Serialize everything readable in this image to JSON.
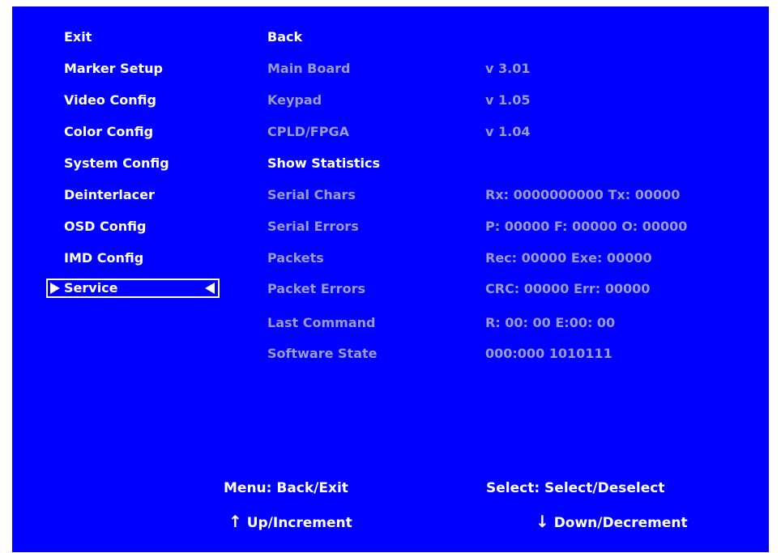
{
  "menu": {
    "items": [
      "Exit",
      "Marker Setup",
      "Video Config",
      "Color Config",
      "System Config",
      "Deinterlacer",
      "OSD Config",
      "IMD Config"
    ],
    "selected": "Service"
  },
  "sub": {
    "back": "Back",
    "main_board": "Main Board",
    "keypad": "Keypad",
    "cpld": "CPLD/FPGA",
    "show_stats": "Show Statistics",
    "serial_chars": "Serial Chars",
    "serial_errors": "Serial Errors",
    "packets": "Packets",
    "packet_errors": "Packet Errors",
    "last_command": "Last Command",
    "software_state": "Software State"
  },
  "values": {
    "main_board": "v 3.01",
    "keypad": "v 1.05",
    "cpld": "v 1.04",
    "serial_chars": "Rx: 0000000000 Tx: 00000",
    "serial_errors": "P: 00000 F: 00000 O: 00000",
    "packets": "Rec: 00000 Exe: 00000",
    "packet_errors": "CRC: 00000 Err: 00000",
    "last_command": "R: 00: 00 E:00: 00",
    "software_state": "000:000 1010111"
  },
  "footer": {
    "menu": "Menu: Back/Exit",
    "select": "Select: Select/Deselect",
    "up": "Up/Increment",
    "down": "Down/Decrement",
    "up_icon": "up-arrow-icon",
    "down_icon": "down-arrow-icon"
  },
  "colors": {
    "background": "#0000ff",
    "active_text": "#ffffff",
    "inactive_text": "#9a9ac8"
  }
}
